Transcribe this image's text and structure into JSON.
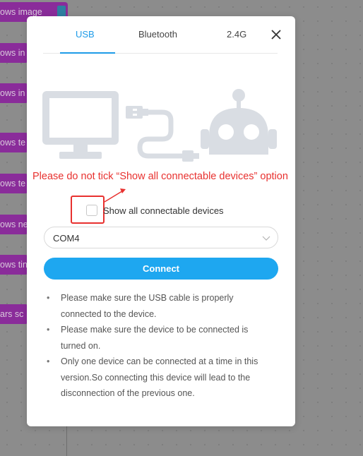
{
  "background": {
    "blocks": [
      {
        "label": "ows image"
      },
      {
        "label": "ows in"
      },
      {
        "label": "ows in"
      },
      {
        "label": "ows te"
      },
      {
        "label": "ows te"
      },
      {
        "label": "ows ne"
      },
      {
        "label": "ows tin"
      },
      {
        "label": "ars sc"
      }
    ]
  },
  "modal": {
    "tabs": [
      {
        "label": "USB",
        "active": true
      },
      {
        "label": "Bluetooth",
        "active": false
      },
      {
        "label": "2.4G",
        "active": false
      }
    ],
    "close_icon": "close-icon",
    "illustration_icons": [
      "computer-monitor-icon",
      "usb-cable-icon",
      "robot-icon"
    ],
    "warning_annotation": "Please do not tick “Show all connectable devices” option",
    "checkbox": {
      "label": "Show all connectable devices",
      "checked": false
    },
    "port_select": {
      "value": "COM4"
    },
    "connect_label": "Connect",
    "notes": [
      "Please make sure the USB cable is properly connected to the device.",
      "Please make sure the device to be connected is turned on.",
      "Only one device can be connected at a time in this version.So connecting this device will lead to the disconnection of the previous one."
    ],
    "bullet": "•"
  },
  "colors": {
    "accent": "#1e9be8",
    "connect_button": "#1ea7f0",
    "warning_red": "#e8312f",
    "block_purple": "#8a2c9a",
    "illustration_gray": "#d9dde3"
  }
}
